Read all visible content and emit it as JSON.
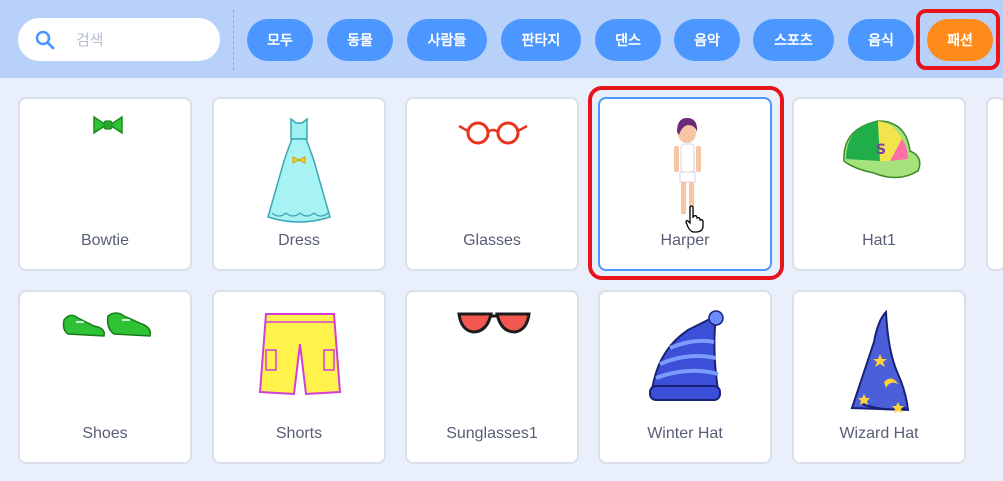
{
  "search": {
    "placeholder": "검색",
    "icon": "search-icon"
  },
  "categories": [
    {
      "label": "모두"
    },
    {
      "label": "동물"
    },
    {
      "label": "사람들"
    },
    {
      "label": "판타지"
    },
    {
      "label": "댄스"
    },
    {
      "label": "음악"
    },
    {
      "label": "스포츠"
    },
    {
      "label": "음식"
    },
    {
      "label": "패션",
      "active": true
    }
  ],
  "sprites": [
    {
      "name": "Bowtie"
    },
    {
      "name": "Dress"
    },
    {
      "name": "Glasses"
    },
    {
      "name": "Harper",
      "selected": true
    },
    {
      "name": "Hat1"
    },
    {
      "name": "Shoes"
    },
    {
      "name": "Shorts"
    },
    {
      "name": "Sunglasses1"
    },
    {
      "name": "Winter Hat"
    },
    {
      "name": "Wizard Hat"
    }
  ],
  "colors": {
    "accent": "#4c97ff",
    "active": "#ff8c1a",
    "highlight": "#e8141c",
    "topbar": "#b8d1fb"
  }
}
